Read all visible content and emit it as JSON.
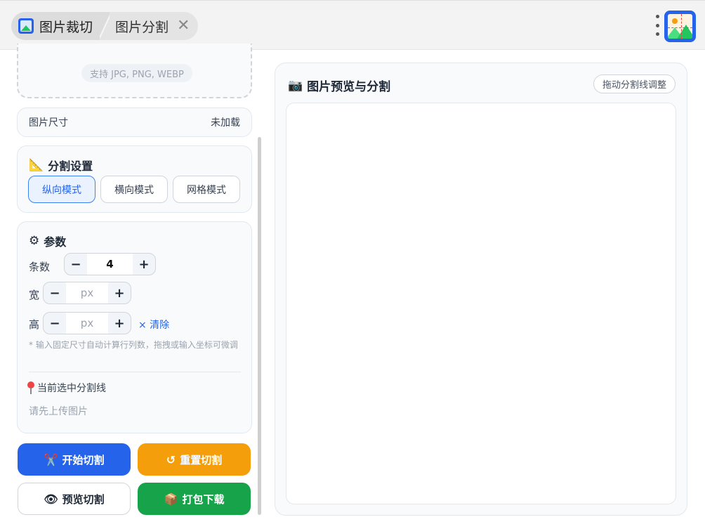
{
  "tabs": [
    {
      "label": "图片裁切",
      "active": true
    },
    {
      "label": "图片分割",
      "closable": true
    }
  ],
  "upload": {
    "formats": "支持 JPG, PNG, WEBP"
  },
  "image_size": {
    "label": "图片尺寸",
    "value": "未加载"
  },
  "split_settings": {
    "title": "分割设置",
    "modes": [
      "纵向模式",
      "横向模式",
      "网格模式"
    ],
    "active_mode": "纵向模式"
  },
  "params": {
    "title": "参数",
    "count_label": "条数",
    "count_value": "4",
    "width_label": "宽",
    "width_placeholder": "px",
    "height_label": "高",
    "height_placeholder": "px",
    "clear_label": "× 清除",
    "hint": "* 输入固定尺寸自动计算行列数，拖拽或输入坐标可微调",
    "current_line_label": "当前选中分割线",
    "empty_message": "请先上传图片"
  },
  "actions": {
    "start": "开始切割",
    "reset": "重置切割",
    "preview": "预览切割",
    "download": "打包下载"
  },
  "preview_panel": {
    "title": "图片预览与分割",
    "drag_hint": "拖动分割线调整"
  },
  "colors": {
    "primary": "#2563eb",
    "reset": "#f59e0b",
    "download": "#16a34a"
  },
  "icons": {
    "split_settings": "triangle-ruler-icon",
    "params": "gear-icon",
    "current_line": "pin-icon",
    "start": "scissors-icon",
    "reset": "refresh-icon",
    "preview": "eye-icon",
    "download": "package-icon",
    "preview_panel": "camera-icon"
  }
}
